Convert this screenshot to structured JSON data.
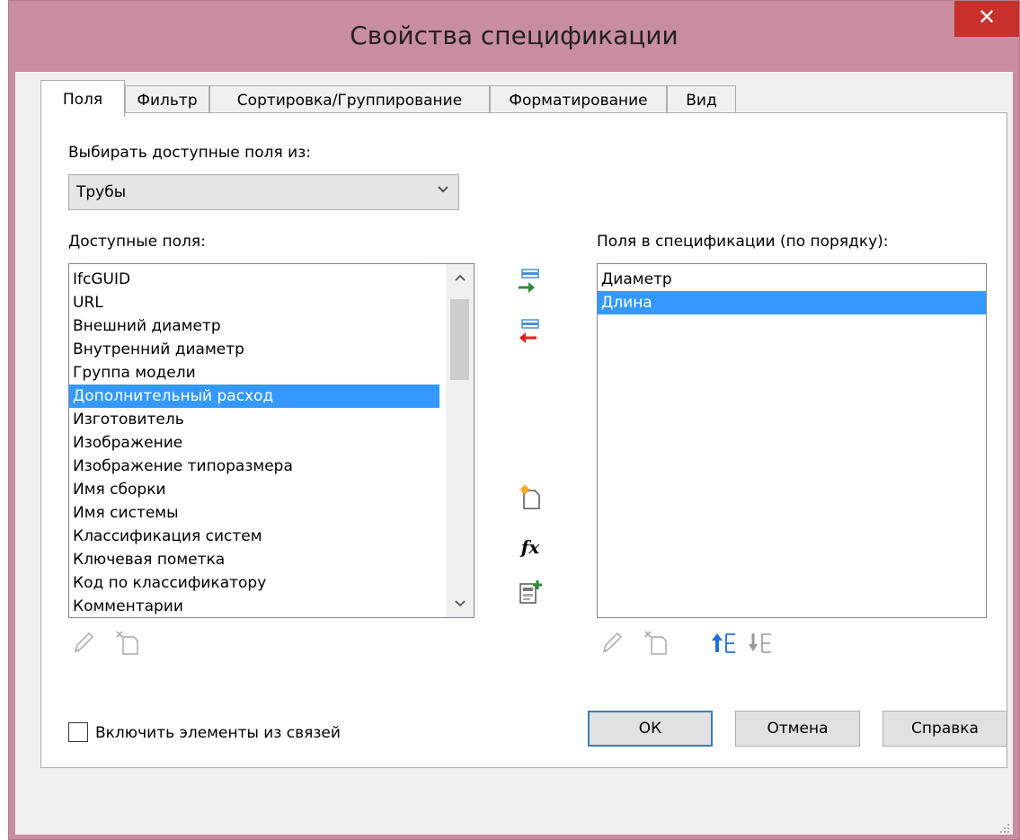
{
  "window": {
    "title": "Свойства спецификации",
    "close_glyph": "✕"
  },
  "tabs": [
    {
      "label": "Поля",
      "active": true
    },
    {
      "label": "Фильтр",
      "active": false
    },
    {
      "label": "Сортировка/Группирование",
      "active": false
    },
    {
      "label": "Форматирование",
      "active": false
    },
    {
      "label": "Вид",
      "active": false
    }
  ],
  "source": {
    "label": "Выбирать доступные поля из:",
    "selected": "Трубы"
  },
  "available": {
    "label": "Доступные поля:",
    "items": [
      "IfcGUID",
      "URL",
      "Внешний диаметр",
      "Внутренний диаметр",
      "Группа модели",
      "Дополнительный расход",
      "Изготовитель",
      "Изображение",
      "Изображение типоразмера",
      "Имя сборки",
      "Имя системы",
      "Классификация систем",
      "Ключевая пометка",
      "Код по классификатору",
      "Комментарии"
    ],
    "selected_index": 5
  },
  "scheduled": {
    "label": "Поля в спецификации (по порядку):",
    "items": [
      "Диаметр",
      "Длина"
    ],
    "selected_index": 1
  },
  "include_links": {
    "label": "Включить элементы из связей",
    "checked": false
  },
  "icons": {
    "add": "add-parameter-icon",
    "remove": "remove-parameter-icon",
    "new_param": "new-parameter-icon",
    "calc": "calculated-value-icon",
    "combine": "combine-parameters-icon",
    "edit": "edit-pencil-icon",
    "delete": "delete-parameter-icon",
    "move_up": "move-up-icon",
    "move_down": "move-down-icon",
    "fx_glyph": "fx"
  },
  "colors": {
    "titlebar": "#c98da0",
    "close": "#c7302b",
    "selection": "#3399ff",
    "add_arrow": "#2e8b3a",
    "remove_arrow": "#e0201a",
    "move_arrow": "#1e6fd9"
  },
  "buttons": {
    "ok": "ОК",
    "cancel": "Отмена",
    "help": "Справка"
  }
}
